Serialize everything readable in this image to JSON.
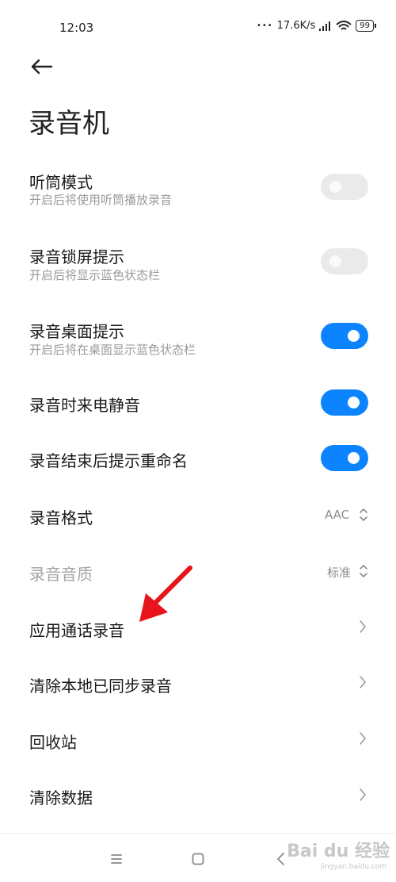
{
  "status": {
    "time": "12:03",
    "dots": "•••",
    "speed": "17.6K/s",
    "battery": "99"
  },
  "header": {
    "back_icon": "back-arrow-icon",
    "title": "录音机"
  },
  "settings": {
    "earpiece_mode": {
      "title": "听筒模式",
      "subtitle": "开启后将使用听筒播放录音",
      "enabled": false
    },
    "lockscreen_hint": {
      "title": "录音锁屏提示",
      "subtitle": "开启后将显示蓝色状态栏",
      "enabled": false
    },
    "desktop_hint": {
      "title": "录音桌面提示",
      "subtitle": "开启后将在桌面显示蓝色状态栏",
      "enabled": true
    },
    "mute_calls": {
      "title": "录音时来电静音",
      "enabled": true
    },
    "rename_prompt": {
      "title": "录音结束后提示重命名",
      "enabled": true
    },
    "format": {
      "title": "录音格式",
      "value": "AAC"
    },
    "quality": {
      "title": "录音音质",
      "value": "标准"
    },
    "call_recording": {
      "title": "应用通话录音"
    },
    "clear_synced": {
      "title": "清除本地已同步录音"
    },
    "recycle_bin": {
      "title": "回收站"
    },
    "clear_data": {
      "title": "清除数据"
    }
  },
  "watermark": {
    "brand": "Bai du 经验",
    "url": "jingyan.baidu.com"
  },
  "colors": {
    "accent": "#0d84ff",
    "annotation_arrow": "#e8141b"
  }
}
